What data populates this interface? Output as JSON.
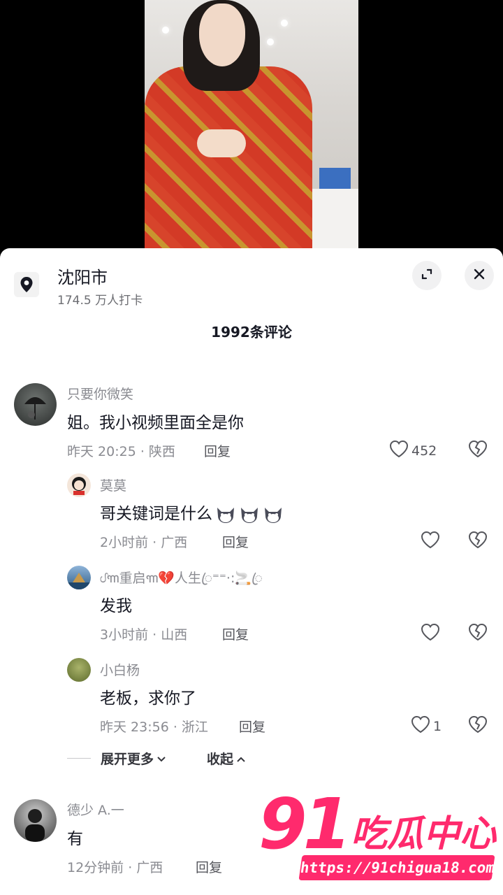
{
  "location": {
    "title": "沈阳市",
    "subtitle": "174.5 万人打卡"
  },
  "comment_count": "1992条评论",
  "comments": [
    {
      "user": "只要你微笑",
      "text": "姐。我小视频里面全是你",
      "meta": "昨天 20:25 · 陕西",
      "reply": "回复",
      "likes": "452"
    },
    {
      "user": "莫莫",
      "text": "哥关键词是什么",
      "meta": "2小时前 · 广西",
      "reply": "回复",
      "likes": ""
    },
    {
      "user": "ᦔ꧑重启꧑💔人生ꦿ⁼⁼·:🚬ꦿ",
      "text": "发我",
      "meta": "3小时前 · 山西",
      "reply": "回复",
      "likes": ""
    },
    {
      "user": "小白杨",
      "text": "老板，求你了",
      "meta": "昨天 23:56 · 浙江",
      "reply": "回复",
      "likes": "1"
    },
    {
      "user": "德少 A.一",
      "text": "有",
      "meta": "12分钟前 · 广西",
      "reply": "回复",
      "likes": ""
    }
  ],
  "expand": {
    "more": "展开更多",
    "collapse": "收起"
  },
  "watermark": {
    "number": "91",
    "name": "吃瓜中心",
    "url": "https://91chigua18.com"
  },
  "icons": {
    "location": "location-pin-icon",
    "fullscreen": "expand-icon",
    "close": "close-icon",
    "like": "heart-icon",
    "dislike": "broken-heart-icon"
  },
  "colors": {
    "watermark": "#ff2a6d",
    "text_primary": "#161823",
    "text_secondary": "#8a8b91"
  }
}
